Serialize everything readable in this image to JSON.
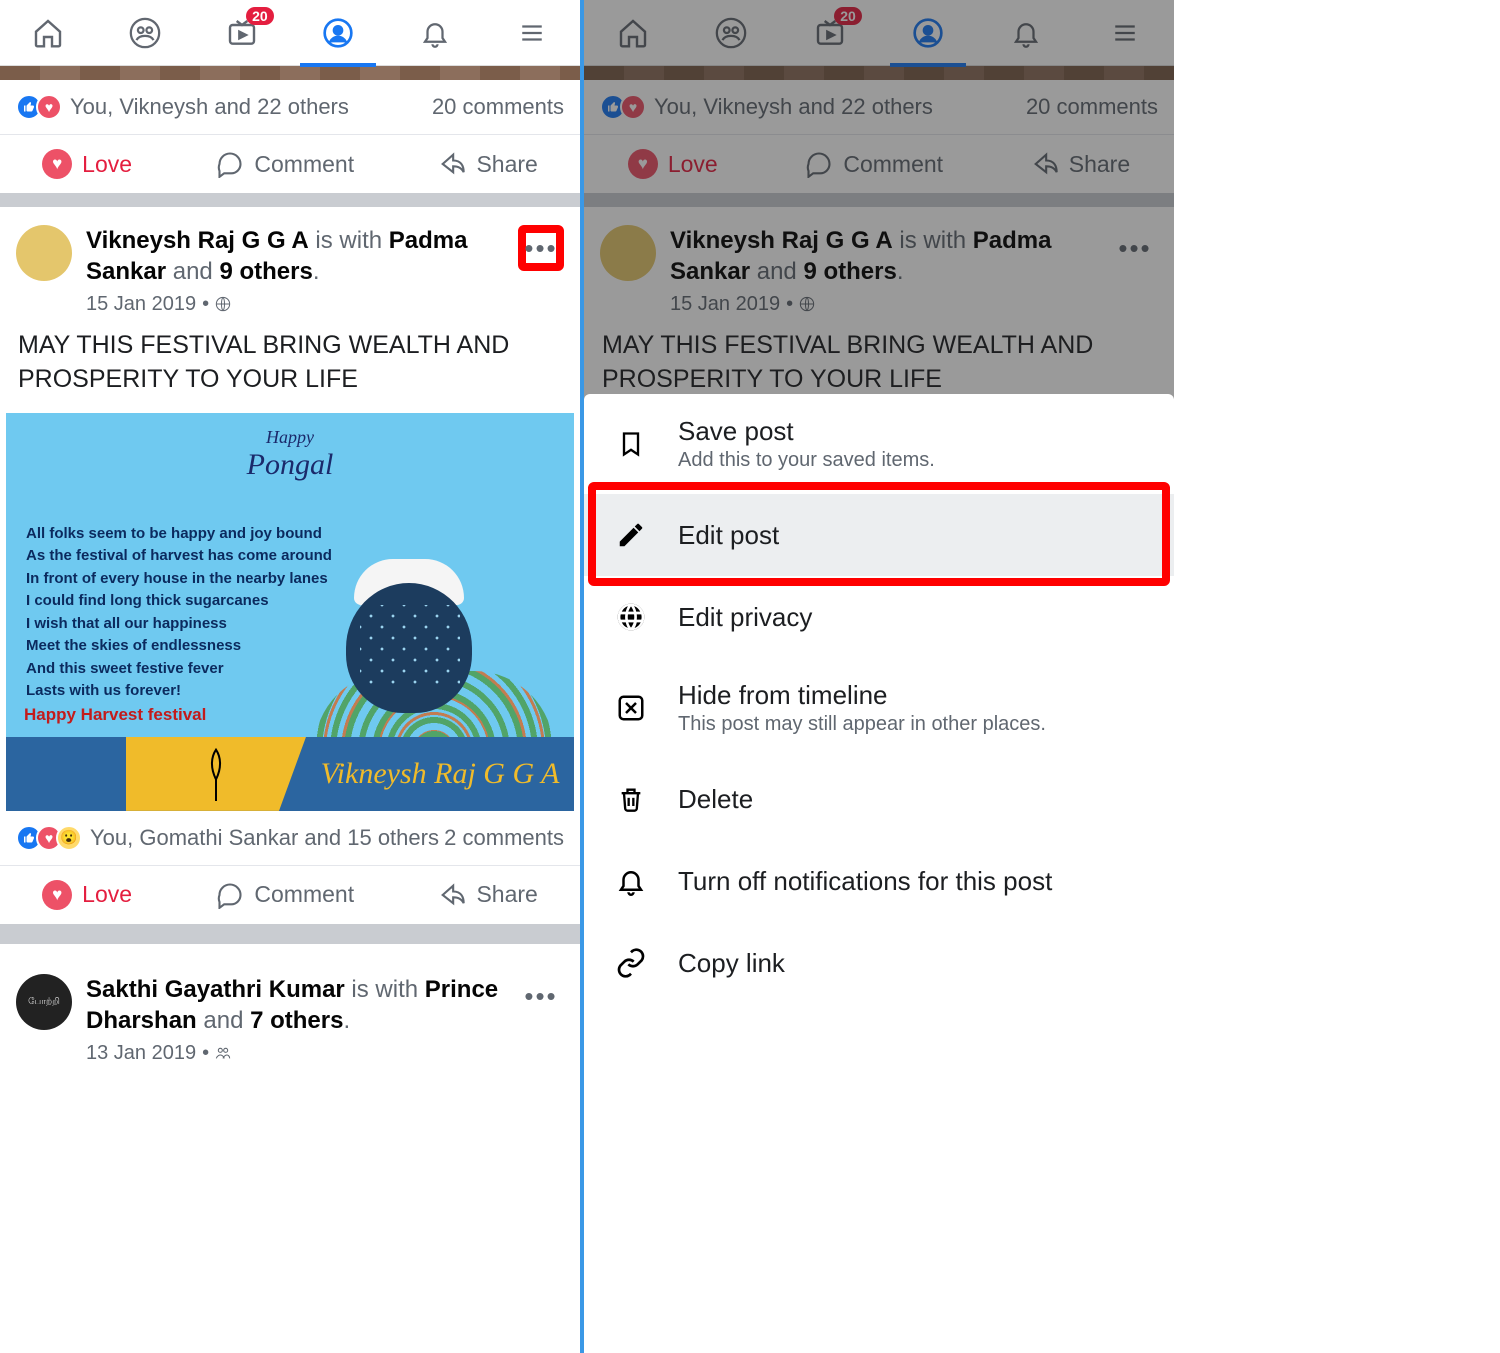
{
  "tabs": {
    "badge": "20"
  },
  "feed_top": {
    "reactions": "You, Vikneysh and 22 others",
    "comments": "20 comments",
    "love": "Love",
    "comment": "Comment",
    "share": "Share"
  },
  "post1": {
    "author": "Vikneysh Raj G G A",
    "is_with": "is with",
    "tagged": "Padma Sankar",
    "and": "and",
    "others": "9 others",
    "date": "15 Jan 2019",
    "body": "MAY THIS FESTIVAL BRING WEALTH AND PROSPERITY TO YOUR LIFE",
    "image": {
      "title_small": "Happy",
      "title": "Pongal",
      "poem": "All folks seem to be happy and joy bound\nAs the festival of harvest has come around\nIn front of every house in the nearby lanes\nI could find long thick sugarcanes\nI wish that all our happiness\nMeet the skies of endlessness\nAnd this sweet festive fever\nLasts with us forever!",
      "harvest": "Happy Harvest festival",
      "signature": "Vikneysh Raj G G A"
    },
    "reactions": "You, Gomathi Sankar and 15 others",
    "comments": "2 comments"
  },
  "post2": {
    "author": "Sakthi Gayathri Kumar",
    "is_with": "is with",
    "tagged": "Prince Dharshan",
    "and": "and",
    "others": "7 others",
    "date": "13 Jan 2019"
  },
  "menu": {
    "save": {
      "title": "Save post",
      "sub": "Add this to your saved items."
    },
    "edit": {
      "title": "Edit post"
    },
    "privacy": {
      "title": "Edit privacy"
    },
    "hide": {
      "title": "Hide from timeline",
      "sub": "This post may still appear in other places."
    },
    "delete": {
      "title": "Delete"
    },
    "notif": {
      "title": "Turn off notifications for this post"
    },
    "copy": {
      "title": "Copy link"
    }
  }
}
